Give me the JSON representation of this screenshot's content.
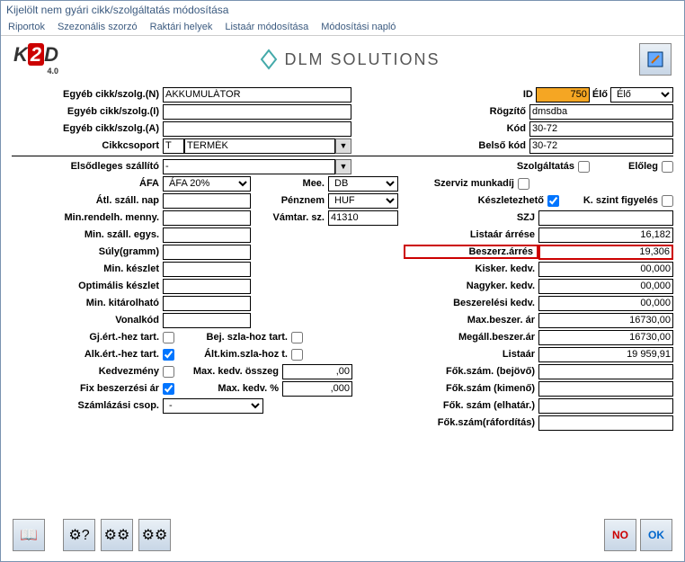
{
  "window": {
    "title": "Kijelölt nem gyári cikk/szolgáltatás módosítása"
  },
  "menu": {
    "riportok": "Riportok",
    "szezon": "Szezonális szorzó",
    "raktar": "Raktári helyek",
    "listaar": "Listaár módosítása",
    "modnaplo": "Módosítási napló"
  },
  "logo": {
    "brand": "DLM SOLUTIONS",
    "k2d_ver": "4.0"
  },
  "labels": {
    "egyeb_n": "Egyéb cikk/szolg.(N)",
    "egyeb_i": "Egyéb cikk/szolg.(I)",
    "egyeb_a": "Egyéb cikk/szolg.(A)",
    "cikkcsoport": "Cikkcsoport",
    "id": "ID",
    "elo": "Élő",
    "rogzito": "Rögzítő",
    "kod": "Kód",
    "belsokod": "Belső kód",
    "elsodleges": "Elsődleges szállító",
    "szolgaltatas": "Szolgáltatás",
    "eloleg": "Előleg",
    "afa": "ÁFA",
    "mee": "Mee.",
    "szerviz": "Szerviz munkadíj",
    "atl": "Átl. száll. nap",
    "penznem": "Pénznem",
    "keszlet": "Készletezhető",
    "kszint": "K. szint figyelés",
    "minrend": "Min.rendelh. menny.",
    "vamtar": "Vámtar. sz.",
    "szj": "SZJ",
    "minszall": "Min. száll. egys.",
    "listaarres": "Listaár árrése",
    "suly": "Súly(gramm)",
    "beszerz": "Beszerz.árrés",
    "minkeszlet": "Min. készlet",
    "kisker": "Kisker. kedv.",
    "optimalis": "Optimális készlet",
    "nagyker": "Nagyker. kedv.",
    "minkitar": "Min. kitárolható",
    "beszer_kedv": "Beszerelési kedv.",
    "vonalkod": "Vonalkód",
    "maxbeszer": "Max.beszer. ár",
    "gjert": "Gj.ért.-hez tart.",
    "bejszla": "Bej. szla-hoz tart.",
    "megall": "Megáll.beszer.ár",
    "alkert": "Alk.ért.-hez tart.",
    "altkim": "Ált.kim.szla-hoz t.",
    "listaar": "Listaár",
    "kedvezmeny": "Kedvezmény",
    "maxkedvossz": "Max. kedv. összeg",
    "fokbejovo": "Fők.szám. (bejövő)",
    "fixbeszer": "Fix beszerzési ár",
    "maxkedvpct": "Max. kedv. %",
    "fokkimeno": "Fők.szám (kimenő)",
    "szamlazasi": "Számlázási csop.",
    "fokelhat": "Fők. szám (elhatár.)",
    "fokraford": "Fők.szám(ráfordítás)"
  },
  "values": {
    "egyeb_n": "AKKUMULÁTOR",
    "egyeb_i": "",
    "egyeb_a": "",
    "cikkcsoport_code": "T",
    "cikkcsoport_name": "TERMÉK",
    "id": "750",
    "elo": "Élő",
    "rogzito": "dmsdba",
    "kod": "30-72",
    "belsokod": "30-72",
    "elsodleges": "-",
    "afa": "ÁFA 20%",
    "mee": "DB",
    "penznem": "HUF",
    "atl": "",
    "minrend": "",
    "vamtar": "41310",
    "szj": "",
    "minszall": "",
    "listaarres": "16,182",
    "suly": "",
    "beszerz": "19,306",
    "minkeszlet": "",
    "kisker": "00,000",
    "optimalis": "",
    "nagyker": "00,000",
    "minkitar": "",
    "beszer_kedv": "00,000",
    "vonalkod": "",
    "maxbeszer": "16730,00",
    "megall": "16730,00",
    "listaar": "19 959,91",
    "maxkedvossz": ",00",
    "maxkedvpct": ",000",
    "fokbejovo": "",
    "fokkimeno": "",
    "fokelhat": "",
    "fokraford": "",
    "szamlazasi": "-"
  },
  "buttons": {
    "no": "NO",
    "ok": "OK"
  }
}
